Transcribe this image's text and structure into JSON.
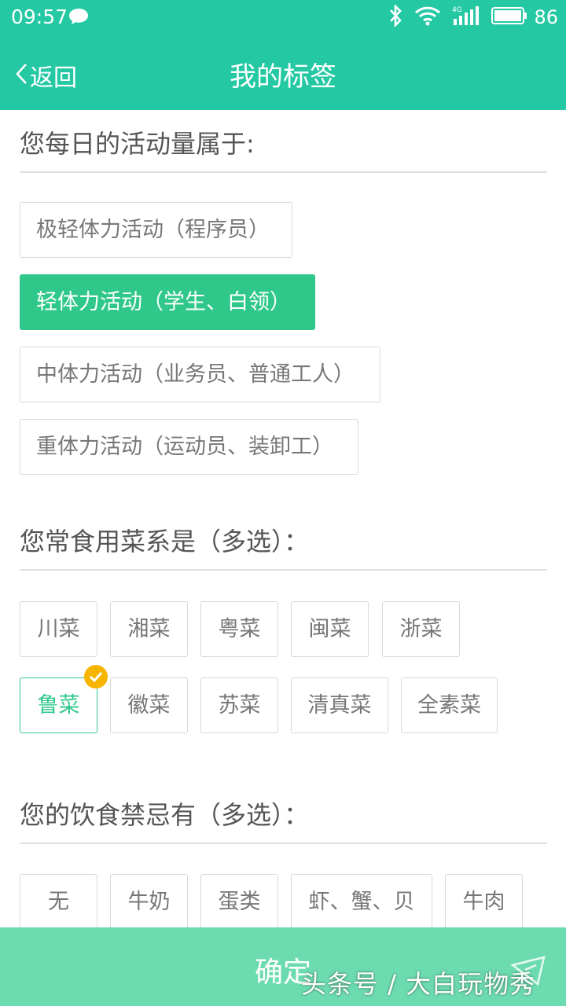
{
  "status_bar": {
    "time": "09:57",
    "battery": "86",
    "network": "4G",
    "icons": [
      "chat-bubble-icon",
      "bluetooth-icon",
      "wifi-icon",
      "signal-icon",
      "battery-icon"
    ]
  },
  "nav": {
    "back_label": "返回",
    "title": "我的标签"
  },
  "activity": {
    "title": "您每日的活动量属于:",
    "options": [
      {
        "label": "极轻体力活动（程序员）",
        "selected": false
      },
      {
        "label": "轻体力活动（学生、白领）",
        "selected": true
      },
      {
        "label": "中体力活动（业务员、普通工人）",
        "selected": false
      },
      {
        "label": "重体力活动（运动员、装卸工）",
        "selected": false
      }
    ]
  },
  "cuisine": {
    "title": "您常食用菜系是（多选）：",
    "options": [
      {
        "label": "川菜",
        "selected": false
      },
      {
        "label": "湘菜",
        "selected": false
      },
      {
        "label": "粤菜",
        "selected": false
      },
      {
        "label": "闽菜",
        "selected": false
      },
      {
        "label": "浙菜",
        "selected": false
      },
      {
        "label": "鲁菜",
        "selected": true
      },
      {
        "label": "徽菜",
        "selected": false
      },
      {
        "label": "苏菜",
        "selected": false
      },
      {
        "label": "清真菜",
        "selected": false
      },
      {
        "label": "全素菜",
        "selected": false
      }
    ]
  },
  "taboo": {
    "title": "您的饮食禁忌有（多选）：",
    "options": [
      {
        "label": "无",
        "selected": false
      },
      {
        "label": "牛奶",
        "selected": false
      },
      {
        "label": "蛋类",
        "selected": false
      },
      {
        "label": "虾、蟹、贝",
        "selected": false
      },
      {
        "label": "牛肉",
        "selected": false
      }
    ]
  },
  "confirm_label": "确定",
  "watermark": "头条号 / 大白玩物秀",
  "colors": {
    "header": "#24c9a3",
    "selected": "#2fc88a",
    "badge": "#f7b500",
    "confirm": "#6ddbb0"
  }
}
